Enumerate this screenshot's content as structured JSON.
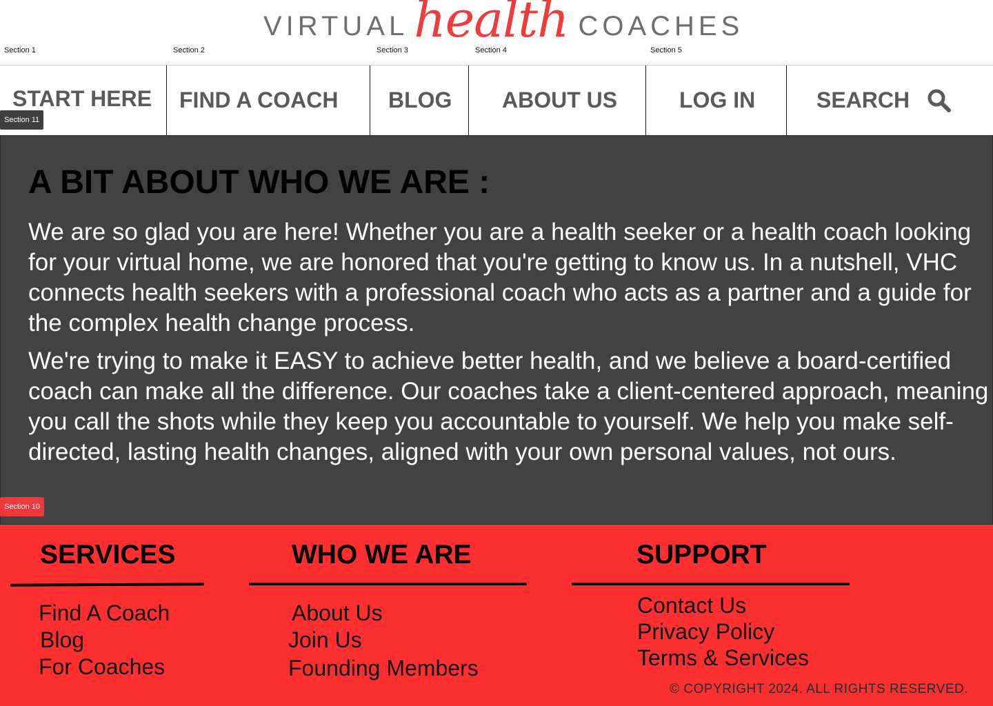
{
  "header": {
    "logo": {
      "left": "VIRTUAL",
      "script": "health",
      "right": "COACHES"
    },
    "section_labels": [
      "Section 1",
      "Section 2",
      "Section 3",
      "Section 4",
      "Section 5"
    ]
  },
  "nav": {
    "items": [
      "START HERE",
      "FIND  A COACH",
      "BLOG",
      "ABOUT US",
      "LOG IN",
      "SEARCH"
    ],
    "search_icon": "search-icon"
  },
  "tags": {
    "nav_section": "Section 11",
    "about_section": "Section 10"
  },
  "about": {
    "title": "A BIT ABOUT WHO WE ARE :",
    "paragraphs": [
      "We are so glad you are here! Whether you are a health seeker or a health coach looking for your virtual home, we are honored that you're getting to know us. In a nutshell, VHC connects health seekers with a professional coach who acts as a partner and a guide for the complex health change process.",
      "We're trying to make it EASY to achieve better health, and we believe a board-certified coach can make all the difference. Our coaches take a client-centered approach, meaning you call the shots while they keep you accountable to yourself. We help you make self-directed, lasting health changes, aligned with your own personal values, not ours."
    ]
  },
  "footer": {
    "services": {
      "title": "SERVICES",
      "links": [
        "Find A Coach",
        "Blog",
        "For Coaches"
      ]
    },
    "who": {
      "title": "WHO WE ARE",
      "links": [
        "About Us",
        "Join Us",
        "Founding Members"
      ]
    },
    "support": {
      "title": "SUPPORT",
      "links": [
        "Contact Us",
        "Privacy Policy",
        "Terms & Services"
      ]
    },
    "copyright": "© COPYRIGHT 2024. ALL RIGHTS RESERVED."
  },
  "colors": {
    "accent_red": "#fd2f30",
    "dark_panel": "#424242",
    "logo_red": "#ee3b3b"
  }
}
